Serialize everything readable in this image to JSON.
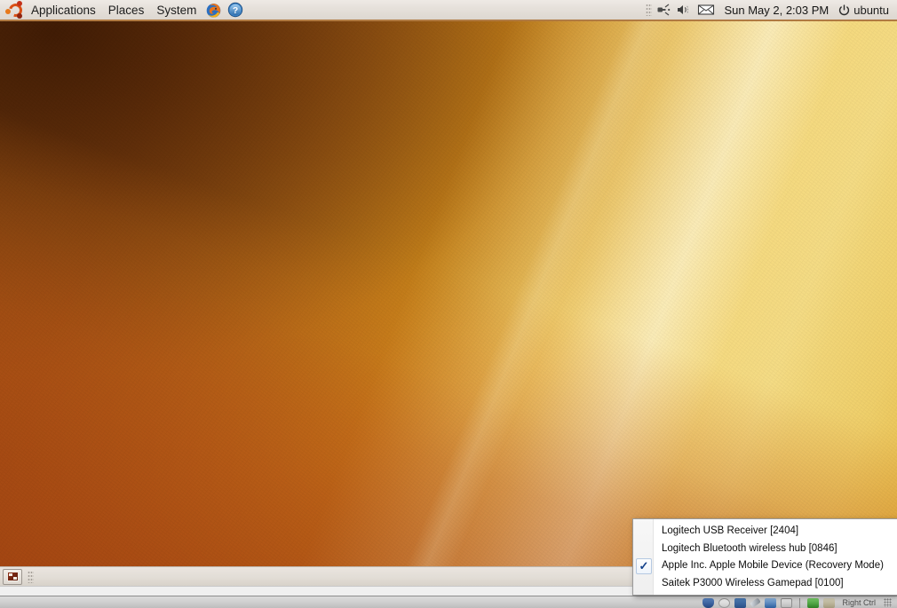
{
  "top_panel": {
    "logo": "ubuntu-logo",
    "menus": [
      {
        "label": "Applications",
        "name": "menu-applications"
      },
      {
        "label": "Places",
        "name": "menu-places"
      },
      {
        "label": "System",
        "name": "menu-system"
      }
    ],
    "launchers": [
      {
        "name": "firefox-launcher",
        "title": "Firefox Web Browser"
      },
      {
        "name": "help-launcher",
        "title": "Ubuntu Help"
      }
    ],
    "tray": [
      {
        "name": "panel-grip",
        "icon": "grip-icon"
      },
      {
        "name": "network-tray",
        "icon": "network-plug-icon"
      },
      {
        "name": "volume-tray",
        "icon": "speaker-icon"
      },
      {
        "name": "mail-tray",
        "icon": "envelope-icon"
      }
    ],
    "clock": "Sun May  2,  2:03 PM",
    "user": {
      "label": "ubuntu",
      "power_icon": "power-icon"
    }
  },
  "bottom_panel": {
    "show_desktop": "show-desktop-button",
    "separator": "panel-separator",
    "workspace_switcher": "workspace-switcher"
  },
  "device_menu": {
    "items": [
      {
        "label": "Logitech USB Receiver [2404]",
        "checked": false
      },
      {
        "label": "Logitech Bluetooth wireless hub [0846]",
        "checked": false
      },
      {
        "label": "Apple Inc. Apple Mobile Device (Recovery Mode)",
        "checked": true
      },
      {
        "label": "Saitek P3000 Wireless Gamepad [0100]",
        "checked": false
      }
    ],
    "check_glyph": "✓"
  },
  "host_taskbar": {
    "label": "Right Ctrl",
    "icons": [
      {
        "name": "host-tray-shield-icon"
      },
      {
        "name": "host-tray-disc-icon"
      },
      {
        "name": "host-tray-monitor-icon"
      },
      {
        "name": "host-tray-pen-icon"
      },
      {
        "name": "host-tray-network-icon"
      },
      {
        "name": "host-tray-battery-icon"
      },
      {
        "name": "host-tray-green-icon"
      },
      {
        "name": "host-tray-vm-icon"
      }
    ]
  },
  "colors": {
    "panel_bg": "#e3ded8",
    "panel_border": "#b07a42",
    "wallpaper_dark": "#6b3a11",
    "wallpaper_mid": "#df9a20",
    "wallpaper_light": "#f3d97f",
    "wallpaper_lower": "#b3521d",
    "menu_bg": "#ffffff",
    "check_color": "#15428b"
  }
}
